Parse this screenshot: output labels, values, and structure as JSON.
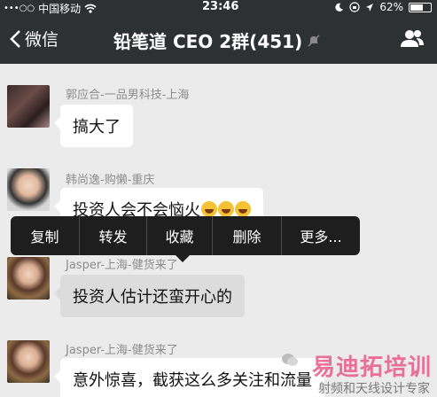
{
  "status_bar": {
    "signal": "•••○○",
    "carrier": "中国移动",
    "time": "23:46",
    "battery": "62%",
    "battery_level": 0.62
  },
  "nav": {
    "back_label": "微信",
    "title": "铅笔道 CEO 2群(451)"
  },
  "messages": [
    {
      "sender": "郭应合-一品男科技-上海",
      "text": "搞大了"
    },
    {
      "sender": "韩尚逸-购懒-重庆",
      "text": "投资人会不会恼火"
    },
    {
      "sender": "Jasper-上海-健货来了",
      "text": "投资人估计还蛮开心的"
    },
    {
      "sender": "Jasper-上海-健货来了",
      "text": "意外惊喜，截获这么多关注和流量"
    }
  ],
  "context_menu": {
    "items": [
      "复制",
      "转发",
      "收藏",
      "删除",
      "更多..."
    ]
  },
  "watermark": {
    "brand": "易迪拓培训",
    "subtitle": "射频和天线设计专家"
  },
  "colors": {
    "bar": "#2e3132",
    "chat_bg": "#ebebeb",
    "watermark": "#e85a8a"
  }
}
